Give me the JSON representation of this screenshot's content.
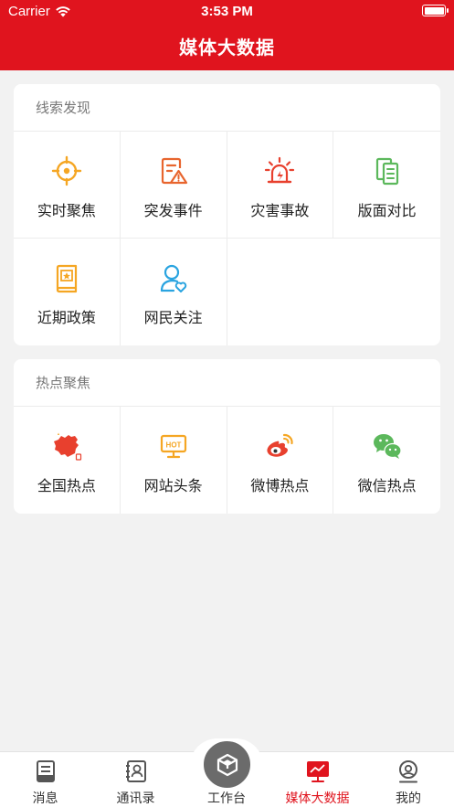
{
  "status_bar": {
    "carrier": "Carrier",
    "time": "3:53 PM"
  },
  "nav": {
    "title": "媒体大数据"
  },
  "colors": {
    "brand": "#e0141e",
    "orange": "#f5a623",
    "green": "#5cb85c",
    "blue": "#2aa4e0",
    "red": "#e8402e"
  },
  "sections": [
    {
      "title": "线索发现",
      "items": [
        {
          "label": "实时聚焦",
          "icon": "target-icon"
        },
        {
          "label": "突发事件",
          "icon": "alert-document-icon"
        },
        {
          "label": "灾害事故",
          "icon": "siren-icon"
        },
        {
          "label": "版面对比",
          "icon": "compare-pages-icon"
        },
        {
          "label": "近期政策",
          "icon": "policy-book-icon"
        },
        {
          "label": "网民关注",
          "icon": "user-heart-icon"
        }
      ]
    },
    {
      "title": "热点聚焦",
      "items": [
        {
          "label": "全国热点",
          "icon": "china-map-icon"
        },
        {
          "label": "网站头条",
          "icon": "hot-monitor-icon"
        },
        {
          "label": "微博热点",
          "icon": "weibo-icon"
        },
        {
          "label": "微信热点",
          "icon": "wechat-icon"
        }
      ]
    }
  ],
  "tabs": [
    {
      "label": "消息",
      "icon": "message-icon"
    },
    {
      "label": "通讯录",
      "icon": "contacts-icon"
    },
    {
      "label": "工作台",
      "icon": "workbench-icon"
    },
    {
      "label": "媒体大数据",
      "icon": "media-data-icon",
      "active": true
    },
    {
      "label": "我的",
      "icon": "profile-icon"
    }
  ]
}
